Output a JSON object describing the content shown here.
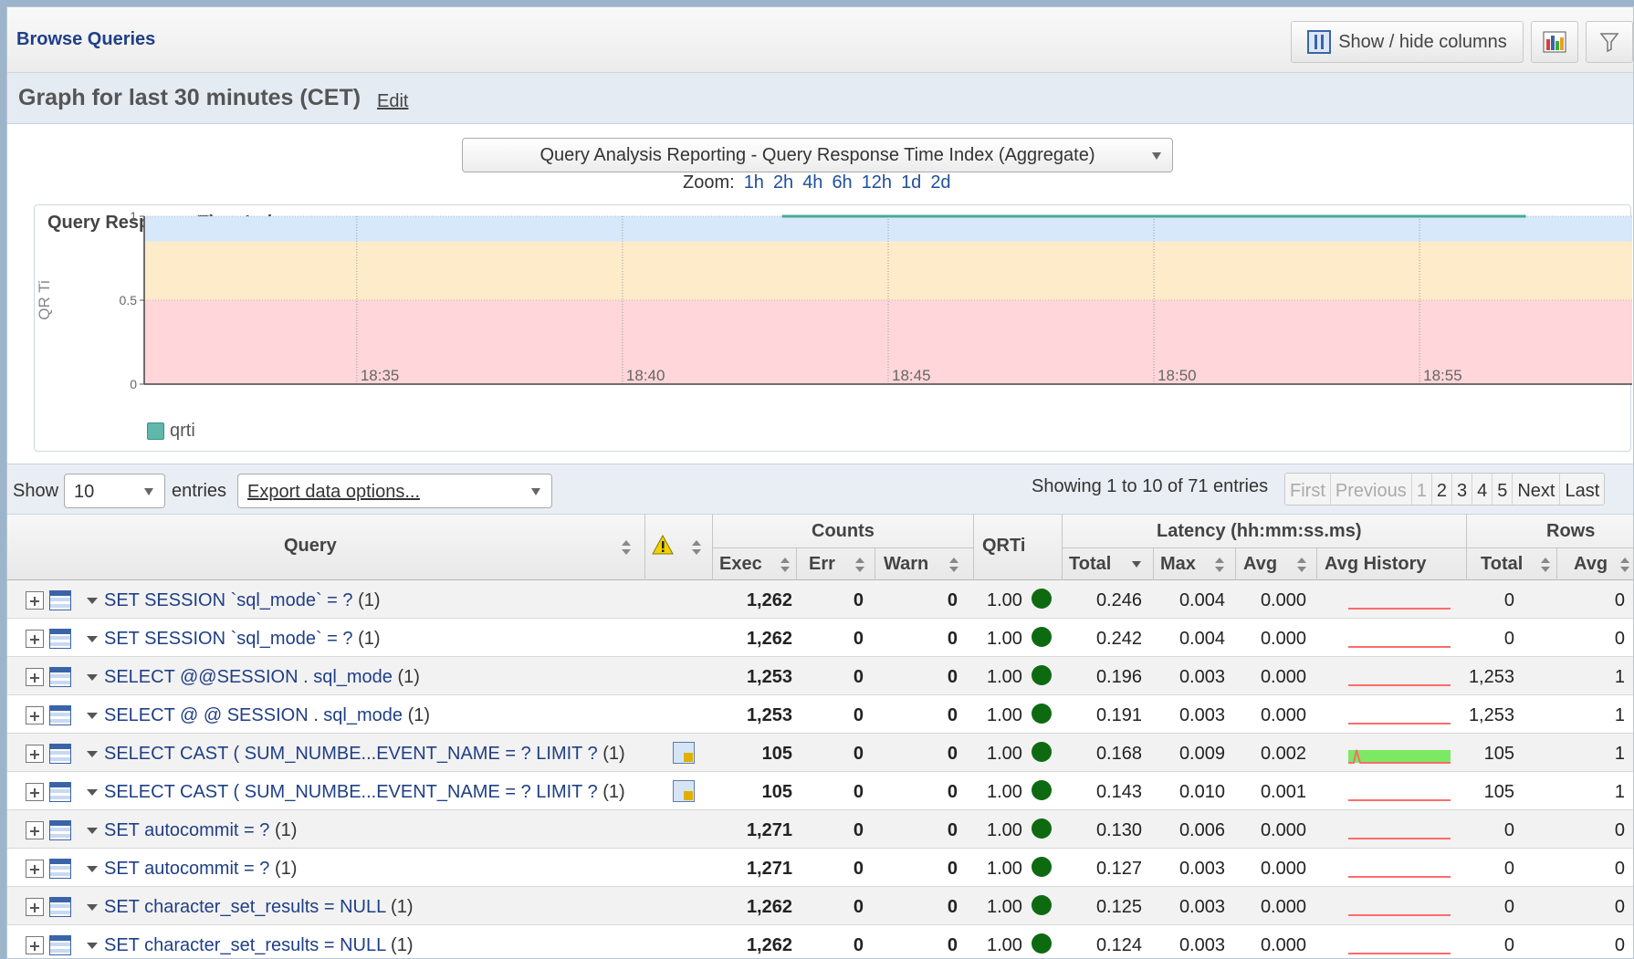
{
  "header": {
    "title": "Browse Queries",
    "show_hide_columns": "Show / hide columns"
  },
  "graph": {
    "heading": "Graph for last 30 minutes (CET)",
    "edit": "Edit",
    "selector": "Query Analysis Reporting - Query Response Time Index (Aggregate)",
    "zoom_label": "Zoom:",
    "zoom_levels": [
      "1h",
      "2h",
      "4h",
      "6h",
      "12h",
      "1d",
      "2d"
    ]
  },
  "chart_data": {
    "type": "area",
    "title": "Query Response Time Index",
    "ylabel": "QR Ti",
    "xlabel": "",
    "ylim": [
      0,
      1
    ],
    "yticks": [
      "1",
      "0.5",
      "0"
    ],
    "xticks": [
      "18:35",
      "18:40",
      "18:45",
      "18:50",
      "18:55"
    ],
    "series": [
      {
        "name": "qrti",
        "x": [
          "18:43",
          "18:45",
          "18:50",
          "18:55",
          "18:57"
        ],
        "values": [
          1,
          1,
          1,
          1,
          1
        ],
        "color": "#4aa898"
      }
    ],
    "bands": [
      {
        "from": 0,
        "to": 0.5,
        "color": "#ffd6d9"
      },
      {
        "from": 0.5,
        "to": 0.85,
        "color": "#fdebc9"
      },
      {
        "from": 0.85,
        "to": 1,
        "color": "#d6e8fa"
      }
    ],
    "legend_position": "bottom-left",
    "grid": true
  },
  "table_controls": {
    "show": "Show",
    "entries_value": "10",
    "entries": "entries",
    "export": "Export data options...",
    "showing": "Showing 1 to 10 of 71 entries",
    "pager": [
      "First",
      "Previous",
      "1",
      "2",
      "3",
      "4",
      "5",
      "Next",
      "Last"
    ]
  },
  "columns": {
    "query": "Query",
    "counts": "Counts",
    "exec": "Exec",
    "err": "Err",
    "warn": "Warn",
    "qrti": "QRTi",
    "latency": "Latency (hh:mm:ss.ms)",
    "total": "Total",
    "max": "Max",
    "avg": "Avg",
    "avg_history": "Avg History",
    "rows": "Rows",
    "rows_total": "Total",
    "rows_avg": "Avg"
  },
  "rows": [
    {
      "query": "SET SESSION `sql_mode` = ?",
      "count": "(1)",
      "warn_icon": false,
      "exec": "1,262",
      "err": "0",
      "warn": "0",
      "qrti": "1.00",
      "total": "0.246",
      "max": "0.004",
      "avg": "0.000",
      "history": "flat",
      "rows_total": "0",
      "rows_avg": "0"
    },
    {
      "query": "SET SESSION `sql_mode` = ?",
      "count": "(1)",
      "warn_icon": false,
      "exec": "1,262",
      "err": "0",
      "warn": "0",
      "qrti": "1.00",
      "total": "0.242",
      "max": "0.004",
      "avg": "0.000",
      "history": "flat",
      "rows_total": "0",
      "rows_avg": "0"
    },
    {
      "query": "SELECT @@SESSION . sql_mode",
      "count": "(1)",
      "warn_icon": false,
      "exec": "1,253",
      "err": "0",
      "warn": "0",
      "qrti": "1.00",
      "total": "0.196",
      "max": "0.003",
      "avg": "0.000",
      "history": "flat",
      "rows_total": "1,253",
      "rows_avg": "1"
    },
    {
      "query": "SELECT @ @ SESSION . sql_mode",
      "count": "(1)",
      "warn_icon": false,
      "exec": "1,253",
      "err": "0",
      "warn": "0",
      "qrti": "1.00",
      "total": "0.191",
      "max": "0.003",
      "avg": "0.000",
      "history": "flat",
      "rows_total": "1,253",
      "rows_avg": "1"
    },
    {
      "query": "SELECT CAST ( SUM_NUMBE...EVENT_NAME = ? LIMIT ?",
      "count": "(1)",
      "warn_icon": true,
      "exec": "105",
      "err": "0",
      "warn": "0",
      "qrti": "1.00",
      "total": "0.168",
      "max": "0.009",
      "avg": "0.002",
      "history": "filled",
      "rows_total": "105",
      "rows_avg": "1"
    },
    {
      "query": "SELECT CAST ( SUM_NUMBE...EVENT_NAME = ? LIMIT ?",
      "count": "(1)",
      "warn_icon": true,
      "exec": "105",
      "err": "0",
      "warn": "0",
      "qrti": "1.00",
      "total": "0.143",
      "max": "0.010",
      "avg": "0.001",
      "history": "flat",
      "rows_total": "105",
      "rows_avg": "1"
    },
    {
      "query": "SET autocommit = ?",
      "count": "(1)",
      "warn_icon": false,
      "exec": "1,271",
      "err": "0",
      "warn": "0",
      "qrti": "1.00",
      "total": "0.130",
      "max": "0.006",
      "avg": "0.000",
      "history": "flat",
      "rows_total": "0",
      "rows_avg": "0"
    },
    {
      "query": "SET autocommit = ?",
      "count": "(1)",
      "warn_icon": false,
      "exec": "1,271",
      "err": "0",
      "warn": "0",
      "qrti": "1.00",
      "total": "0.127",
      "max": "0.003",
      "avg": "0.000",
      "history": "flat",
      "rows_total": "0",
      "rows_avg": "0"
    },
    {
      "query": "SET character_set_results = NULL",
      "count": "(1)",
      "warn_icon": false,
      "exec": "1,262",
      "err": "0",
      "warn": "0",
      "qrti": "1.00",
      "total": "0.125",
      "max": "0.003",
      "avg": "0.000",
      "history": "flat",
      "rows_total": "0",
      "rows_avg": "0"
    },
    {
      "query": "SET character_set_results = NULL",
      "count": "(1)",
      "warn_icon": false,
      "exec": "1,262",
      "err": "0",
      "warn": "0",
      "qrti": "1.00",
      "total": "0.124",
      "max": "0.003",
      "avg": "0.000",
      "history": "flat",
      "rows_total": "0",
      "rows_avg": "0"
    }
  ],
  "colors": {
    "link": "#1f3f86",
    "qrti_good": "#0d6a10",
    "history_line": "#ff6b6b",
    "history_fill": "#7de864"
  }
}
